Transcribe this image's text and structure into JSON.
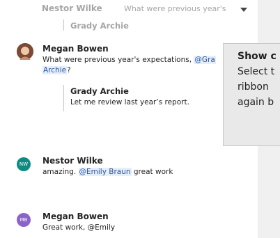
{
  "top_thread": {
    "author": "Nestor Wilke",
    "preview": "What were previous year's",
    "reply_author": "Grady Archie"
  },
  "thread1": {
    "author": "Megan Bowen",
    "text_before": "What were previous year's expectations, ",
    "mention_part1": "@Gra",
    "mention_part2": "Archie",
    "text_after": "?",
    "reply": {
      "author": "Grady Archie",
      "text": "Let me review last year’s report."
    }
  },
  "thread2": {
    "author": "Nestor Wilke",
    "initials": "NW",
    "text_before": "amazing. ",
    "mention": "@Emily Braun",
    "text_after": " great work"
  },
  "thread3": {
    "author": "Megan Bowen",
    "initials": "MB",
    "text": "Great work, @Emily"
  },
  "tooltip": {
    "title": "Show c",
    "line1": "Select t",
    "line2": "ribbon",
    "line3": "again b"
  },
  "colors": {
    "nw_avatar": "#0f8a83",
    "mb_avatar": "#8a64c8",
    "mention_bg": "#e6eefa",
    "mention_text": "#2b579a"
  }
}
